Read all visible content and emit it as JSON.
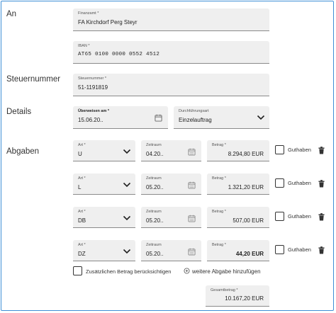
{
  "sections": {
    "an": "An",
    "steuernummer": "Steuernummer",
    "details": "Details",
    "abgaben": "Abgaben"
  },
  "finanzamt": {
    "label": "Finanzamt *",
    "value": "FA Kirchdorf Perg Steyr"
  },
  "iban": {
    "label": "IBAN *",
    "value": "AT65 0100 0000 0552 4512"
  },
  "steuernummer": {
    "label": "Steuernummer *",
    "value": "51-1191819"
  },
  "details": {
    "ueberweisen": {
      "label": "Überweisen am *",
      "value": "15.06.20.."
    },
    "durchfuehrung": {
      "label": "Durchführungsart",
      "value": "Einzelauftrag"
    }
  },
  "abgaben_rows": [
    {
      "art_label": "Art *",
      "art": "U",
      "zeitraum_label": "Zeitraum",
      "zeitraum": "04.20..",
      "betrag_label": "Betrag *",
      "betrag": "8.294,80 EUR",
      "guthaben": "Guthaben",
      "bold": false
    },
    {
      "art_label": "Art *",
      "art": "L",
      "zeitraum_label": "Zeitraum",
      "zeitraum": "05.20..",
      "betrag_label": "Betrag *",
      "betrag": "1.321,20 EUR",
      "guthaben": "Guthaben",
      "bold": false
    },
    {
      "art_label": "Art *",
      "art": "DB",
      "zeitraum_label": "Zeitraum",
      "zeitraum": "05.20..",
      "betrag_label": "Betrag *",
      "betrag": "507,00 EUR",
      "guthaben": "Guthaben",
      "bold": false
    },
    {
      "art_label": "Art *",
      "art": "DZ",
      "zeitraum_label": "Zeitraum",
      "zeitraum": "05.20..",
      "betrag_label": "Betrag *",
      "betrag": "44,20 EUR",
      "guthaben": "Guthaben",
      "bold": true
    }
  ],
  "zusaetzlich": "Zusätzlichen Betrag berücksichtigen",
  "weitere": "weitere Abgabe hinzufügen",
  "gesamt": {
    "label": "Gesamtbetrag *",
    "value": "10.167,20 EUR"
  },
  "colors": {
    "frame": "#3f8fd6",
    "field_bg": "#efefef"
  }
}
